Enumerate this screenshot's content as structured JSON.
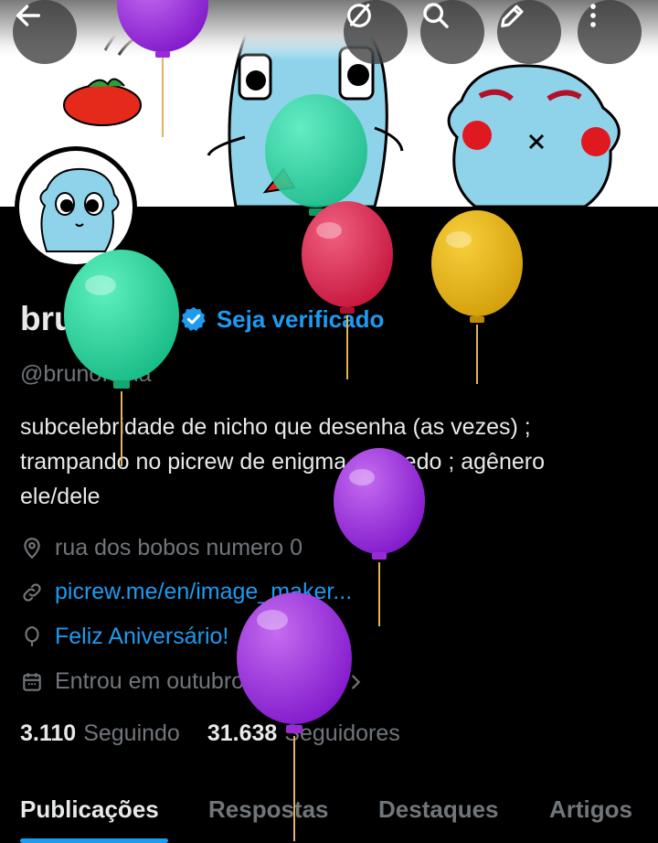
{
  "header": {
    "back_icon": "arrow-left-icon",
    "actions": [
      "hide-balloons-icon",
      "search-icon",
      "edit-icon",
      "more-vertical-icon"
    ]
  },
  "profile": {
    "name": "bruno",
    "verify_label": "Seja verificado",
    "handle": "@brunofobia",
    "bio": "subcelebridade de nicho que desenha (as vezes) ;\ntrampando no picrew de enigma do medo ;  agênero\nele/dele",
    "location": "rua dos bobos numero 0",
    "website": "picrew.me/en/image_maker...",
    "birthday": "Feliz Aniversário!",
    "joined": "Entrou em outubro de 2021",
    "following_count": "3.110",
    "following_label": "Seguindo",
    "followers_count": "31.638",
    "followers_label": "Seguidores"
  },
  "tabs": [
    {
      "label": "Publicações",
      "active": true
    },
    {
      "label": "Respostas",
      "active": false
    },
    {
      "label": "Destaques",
      "active": false
    },
    {
      "label": "Artigos",
      "active": false
    }
  ],
  "colors": {
    "accent": "#1d9bf0",
    "background": "#000000",
    "text_primary": "#e7e9ea",
    "text_secondary": "#71767b"
  }
}
